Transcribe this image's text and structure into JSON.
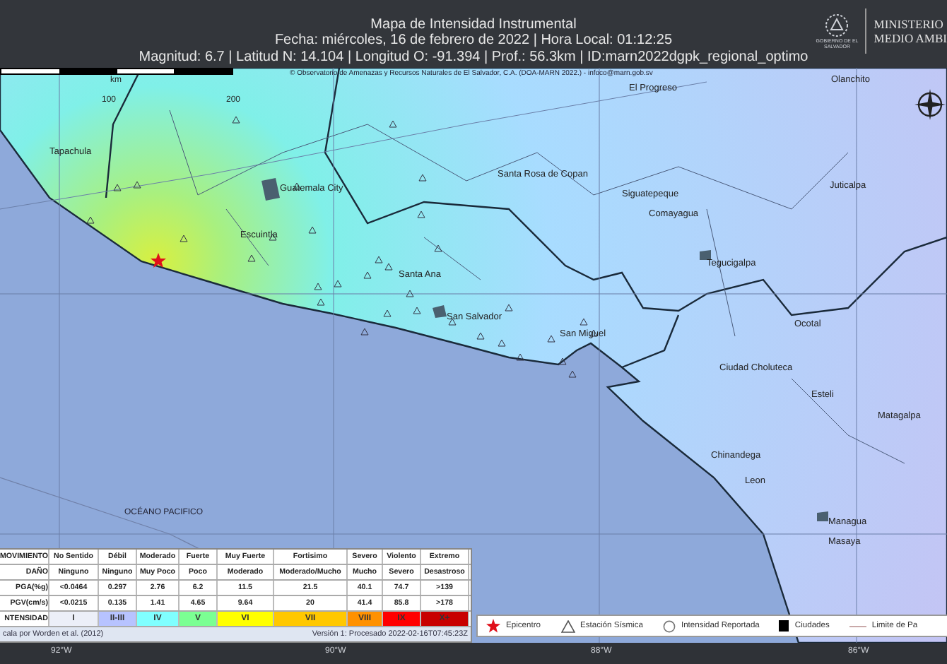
{
  "header": {
    "title": "Mapa de Intensidad Instrumental",
    "date_line": "Fecha: miércoles, 16 de febrero de 2022 | Hora Local: 01:12:25",
    "params_line": "Magnitud: 6.7 | Latitud N: 14.104 | Longitud O: -91.394 | Prof.: 56.3km | ID:marn2022dgpk_regional_optimo",
    "logo_caption": "GOBIERNO DE EL SALVADOR",
    "ministry": [
      "MINISTERIO",
      "MEDIO AMBI"
    ]
  },
  "map": {
    "copyright": "© Observatorio de Amenazas y Recursos Naturales de El Salvador, C.A. (DOA-MARN 2022.) - infoco@marn.gob.sv",
    "scale_labels": [
      "km",
      "100",
      "200"
    ],
    "ocean_label": "OCÉANO PACIFICO",
    "cities": [
      "Tapachula",
      "Guatemala City",
      "Escuintla",
      "Santa Ana",
      "San Salvador",
      "San Miguel",
      "Santa Rosa de Copan",
      "Siguatepeque",
      "Comayagua",
      "Tegucigalpa",
      "Juticalpa",
      "El Progreso",
      "Olanchito",
      "Ocotal",
      "Ciudad Choluteca",
      "Esteli",
      "Matagalpa",
      "Chinandega",
      "Leon",
      "Managua",
      "Masaya"
    ]
  },
  "intensity_table": {
    "rows": [
      {
        "label": "MOVIMIENTO",
        "cells": [
          "No Sentido",
          "Débil",
          "Moderado",
          "Fuerte",
          "Muy Fuerte",
          "Fortisimo",
          "Severo",
          "Violento",
          "Extremo"
        ]
      },
      {
        "label": "DAÑO",
        "cells": [
          "Ninguno",
          "Ninguno",
          "Muy Poco",
          "Poco",
          "Moderado",
          "Moderado/Mucho",
          "Mucho",
          "Severo",
          "Desastroso"
        ]
      },
      {
        "label": "PGA(%g)",
        "cells": [
          "<0.0464",
          "0.297",
          "2.76",
          "6.2",
          "11.5",
          "21.5",
          "40.1",
          "74.7",
          ">139"
        ]
      },
      {
        "label": "PGV(cm/s)",
        "cells": [
          "<0.0215",
          "0.135",
          "1.41",
          "4.65",
          "9.64",
          "20",
          "41.4",
          "85.8",
          ">178"
        ]
      }
    ],
    "intensity": {
      "label": "NTENSIDAD",
      "cells": [
        {
          "text": "I",
          "color": "#eceff8"
        },
        {
          "text": "II-III",
          "color": "#b7c3ff"
        },
        {
          "text": "IV",
          "color": "#80ffff"
        },
        {
          "text": "V",
          "color": "#7bff93"
        },
        {
          "text": "VI",
          "color": "#ffff00"
        },
        {
          "text": "VII",
          "color": "#ffc800"
        },
        {
          "text": "VIII",
          "color": "#ff9100"
        },
        {
          "text": "IX",
          "color": "#ff0000"
        },
        {
          "text": "X+",
          "color": "#c80000"
        }
      ]
    },
    "footer_left": "cala por Worden et al. (2012)",
    "footer_right": "Versión 1: Procesado 2022-02-16T07:45:23Z"
  },
  "legend": [
    {
      "kind": "star",
      "label": "Epicentro"
    },
    {
      "kind": "triangle",
      "label": "Estación Sísmica"
    },
    {
      "kind": "circle",
      "label": "Intensidad Reportada"
    },
    {
      "kind": "square",
      "label": "Ciudades"
    },
    {
      "kind": "line",
      "label": "Limite de Pa"
    }
  ],
  "longitudes": [
    "92°W",
    "90°W",
    "88°W",
    "86°W"
  ]
}
